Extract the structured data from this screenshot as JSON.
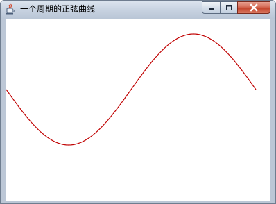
{
  "window": {
    "title": "一个周期的正弦曲线"
  },
  "icons": {
    "app": "java-cup-icon",
    "minimize": "minimize-icon",
    "maximize": "maximize-icon",
    "close": "close-icon"
  },
  "colors": {
    "curve": "#c00000",
    "canvas_background": "#ffffff"
  },
  "plot": {
    "function": "sine",
    "periods": 1
  }
}
